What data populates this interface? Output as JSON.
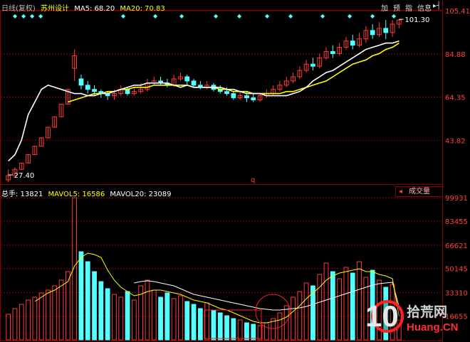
{
  "header": {
    "period_label": "日线(复权)",
    "stock_name": "苏州设计",
    "ma5_label": "MA5: 68.20",
    "ma20_label": "MA20: 70.83",
    "buttons": [
      "加",
      "预",
      "指",
      "信息"
    ]
  },
  "volume_header": {
    "total_label": "总手: 13821",
    "mavol5_label": "MAVOL5: 16586",
    "mavol20_label": "MAVOL20: 23089",
    "dropdown": "成交量"
  },
  "annotations": {
    "low_price": "27.40",
    "high_price": "101.30",
    "marker": "q"
  },
  "watermark": {
    "text": "拾荒网",
    "sub": "Huang.CN",
    "num": "10"
  },
  "colors": {
    "up": "#ff3a3a",
    "down": "#54ffff",
    "ma5": "#ffffff",
    "ma20": "#ffff00",
    "grid": "#8b0000",
    "axis_label": "#ff4040"
  },
  "chart_data": [
    {
      "type": "candlestick",
      "title": "苏州设计",
      "ylim": [
        23.31,
        105.41
      ],
      "y_ticks": [
        "105.41",
        "84.88",
        "64.35",
        "43.82"
      ],
      "series": [
        {
          "name": "MA5",
          "values": [
            34,
            37,
            44,
            56,
            62,
            68,
            70,
            69,
            68,
            67,
            66,
            66,
            65,
            65,
            66,
            66,
            67,
            68,
            69,
            70,
            70,
            71,
            71,
            71,
            71,
            70,
            69,
            70,
            69,
            69,
            69,
            69,
            69,
            68,
            68,
            67,
            66,
            66,
            66,
            65,
            65,
            65,
            65,
            66,
            67,
            69,
            72,
            74,
            76,
            77,
            79,
            81,
            83,
            85,
            87,
            88,
            89,
            90,
            90,
            91
          ]
        },
        {
          "name": "MA20",
          "values": [
            null,
            null,
            null,
            null,
            null,
            null,
            null,
            null,
            null,
            62,
            63,
            64,
            65,
            66,
            66,
            67,
            67,
            68,
            68,
            69,
            69,
            69,
            70,
            70,
            70,
            70,
            70,
            70,
            69,
            69,
            69,
            69,
            68,
            68,
            67,
            67,
            67,
            66,
            66,
            66,
            66,
            66,
            67,
            67,
            68,
            69,
            70,
            71,
            72,
            74,
            76,
            78,
            80,
            81,
            82,
            84,
            85,
            87,
            88,
            90
          ]
        }
      ],
      "candles": [
        [
          25,
          27,
          30,
          24
        ],
        [
          27,
          30,
          31,
          27
        ],
        [
          30,
          33,
          33,
          30
        ],
        [
          33,
          37,
          37,
          33
        ],
        [
          37,
          41,
          41,
          37
        ],
        [
          41,
          45,
          45,
          41
        ],
        [
          45,
          50,
          50,
          45
        ],
        [
          50,
          55,
          55,
          50
        ],
        [
          55,
          61,
          61,
          55
        ],
        [
          61,
          68,
          68,
          61
        ],
        [
          78,
          84,
          87,
          72
        ],
        [
          73,
          70,
          75,
          68
        ],
        [
          70,
          68,
          72,
          66
        ],
        [
          68,
          67,
          70,
          65
        ],
        [
          67,
          66,
          68,
          64
        ],
        [
          66,
          65,
          67,
          63
        ],
        [
          65,
          66,
          68,
          63
        ],
        [
          66,
          68,
          70,
          65
        ],
        [
          68,
          66,
          69,
          65
        ],
        [
          66,
          67,
          69,
          65
        ],
        [
          67,
          68,
          71,
          66
        ],
        [
          68,
          71,
          73,
          67
        ],
        [
          71,
          72,
          74,
          70
        ],
        [
          72,
          71,
          74,
          70
        ],
        [
          71,
          70,
          73,
          69
        ],
        [
          70,
          73,
          75,
          69
        ],
        [
          73,
          74,
          76,
          72
        ],
        [
          74,
          72,
          75,
          70
        ],
        [
          72,
          70,
          73,
          69
        ],
        [
          70,
          69,
          72,
          68
        ],
        [
          69,
          70,
          72,
          68
        ],
        [
          70,
          68,
          71,
          67
        ],
        [
          68,
          67,
          70,
          66
        ],
        [
          67,
          66,
          69,
          65
        ],
        [
          66,
          64,
          67,
          63
        ],
        [
          64,
          65,
          67,
          63
        ],
        [
          65,
          64,
          67,
          62
        ],
        [
          64,
          63,
          66,
          62
        ],
        [
          63,
          65,
          66,
          62
        ],
        [
          65,
          66,
          68,
          64
        ],
        [
          66,
          68,
          70,
          65
        ],
        [
          68,
          70,
          72,
          67
        ],
        [
          70,
          72,
          74,
          69
        ],
        [
          72,
          74,
          76,
          71
        ],
        [
          74,
          77,
          79,
          73
        ],
        [
          77,
          80,
          82,
          76
        ],
        [
          80,
          79,
          83,
          77
        ],
        [
          79,
          83,
          85,
          78
        ],
        [
          83,
          86,
          88,
          82
        ],
        [
          86,
          85,
          89,
          83
        ],
        [
          85,
          88,
          90,
          84
        ],
        [
          88,
          91,
          93,
          87
        ],
        [
          91,
          89,
          94,
          87
        ],
        [
          89,
          92,
          95,
          88
        ],
        [
          92,
          96,
          98,
          90
        ],
        [
          96,
          94,
          99,
          92
        ],
        [
          94,
          97,
          100,
          93
        ],
        [
          97,
          95,
          101,
          92
        ],
        [
          95,
          99,
          101,
          93
        ],
        [
          99,
          101,
          101.3,
          97
        ]
      ]
    },
    {
      "type": "bar",
      "title": "成交量",
      "ylim": [
        0,
        100000
      ],
      "y_ticks": [
        "99931",
        "83455",
        "66621",
        "50145",
        "33310",
        "16655"
      ],
      "values": [
        18000,
        22000,
        25000,
        28000,
        30000,
        33000,
        35000,
        38000,
        42000,
        48000,
        99931,
        62000,
        55000,
        48000,
        41000,
        36000,
        32000,
        30000,
        34000,
        28000,
        38000,
        42000,
        35000,
        30000,
        33000,
        29000,
        31000,
        27000,
        25000,
        22000,
        26000,
        21000,
        19000,
        17000,
        15000,
        14000,
        12000,
        11000,
        10000,
        12000,
        15000,
        19000,
        24000,
        30000,
        34000,
        40000,
        38000,
        46000,
        54000,
        48000,
        43000,
        51000,
        47000,
        55000,
        44000,
        49000,
        42000,
        37000,
        39000,
        13821
      ],
      "series": [
        {
          "name": "MAVOL5",
          "values": [
            null,
            null,
            null,
            null,
            27000,
            30000,
            33000,
            35000,
            38000,
            41000,
            52000,
            58000,
            61000,
            60000,
            58000,
            49000,
            42000,
            37000,
            34000,
            31000,
            32000,
            34000,
            35000,
            35000,
            34000,
            33000,
            32000,
            30000,
            28000,
            27000,
            26000,
            24000,
            22000,
            21000,
            19000,
            17000,
            15000,
            13000,
            12000,
            12000,
            13000,
            14000,
            16000,
            20000,
            24000,
            29000,
            33000,
            37000,
            42000,
            45000,
            47000,
            48000,
            49000,
            50000,
            48000,
            48000,
            46000,
            45000,
            43000,
            16586
          ]
        },
        {
          "name": "MAVOL20",
          "values": [
            null,
            null,
            null,
            null,
            null,
            null,
            null,
            null,
            null,
            null,
            null,
            null,
            null,
            null,
            null,
            null,
            null,
            null,
            null,
            40000,
            41000,
            41500,
            41000,
            40000,
            39000,
            38000,
            36000,
            34000,
            32000,
            31000,
            30000,
            29000,
            28000,
            27000,
            26000,
            25000,
            24000,
            23000,
            22000,
            21500,
            21000,
            21000,
            21500,
            22000,
            22500,
            23500,
            25000,
            26500,
            28000,
            29500,
            31000,
            32500,
            34000,
            35500,
            37000,
            38500,
            39500,
            40000,
            40500,
            23089
          ]
        }
      ]
    }
  ]
}
